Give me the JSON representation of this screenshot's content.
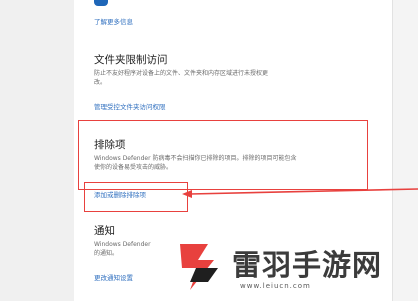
{
  "top": {
    "learn_more": "了解更多信息"
  },
  "folder_access": {
    "heading": "文件夹限制访问",
    "description_line1": "防止不友好程序对设备上的文件、文件夹和内存区域进行未授权更",
    "description_line2": "改。",
    "link": "管理受控文件夹访问权限"
  },
  "exclusions": {
    "heading": "排除项",
    "description_line1": "Windows Defender 防病毒不会扫描你已排除的项目。排除的项目可能包含",
    "description_line2": "使你的设备易受攻击的威胁。",
    "link": "添加或删除排除项"
  },
  "notifications": {
    "heading": "通知",
    "description_line1": "Windows Defender",
    "description_line2": "的通知。",
    "link": "更改通知设置"
  },
  "watermark": {
    "title": "雷羽手游网",
    "url": "www.leiucn.com"
  },
  "colors": {
    "accent": "#2f6fbf",
    "annotation": "#e8413e"
  }
}
